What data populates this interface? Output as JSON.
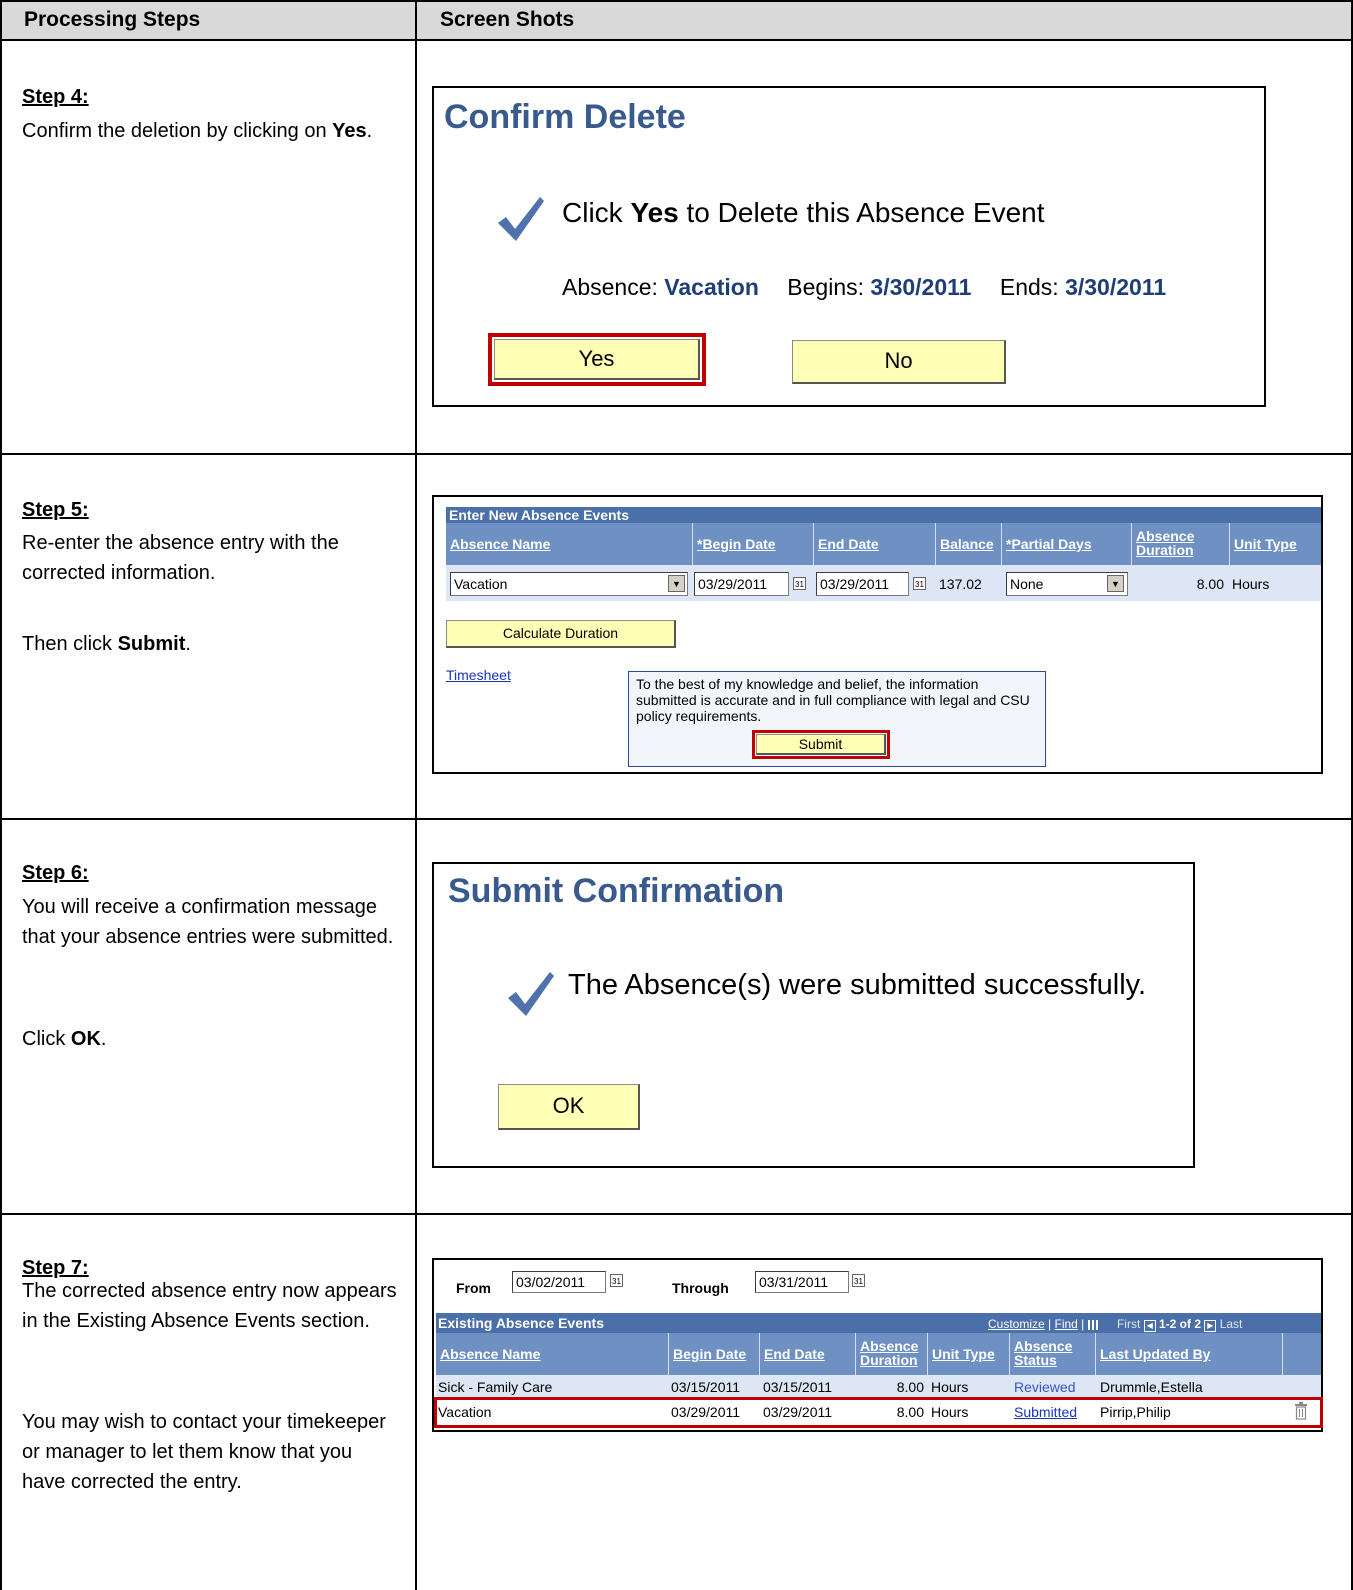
{
  "header": {
    "col1": "Processing Steps",
    "col2": "Screen Shots"
  },
  "step4": {
    "title": "Step 4:",
    "text_pre": "Confirm the deletion by clicking on ",
    "text_bold": "Yes",
    "text_post": ".",
    "shot": {
      "heading": "Confirm Delete",
      "msg_pre": "Click ",
      "msg_bold": "Yes",
      "msg_post": " to Delete this Absence Event",
      "absence_label": "Absence:",
      "absence_value": "Vacation",
      "begins_label": "Begins:",
      "begins_value": "3/30/2011",
      "ends_label": "Ends:",
      "ends_value": "3/30/2011",
      "yes_label": "Yes",
      "no_label": "No"
    }
  },
  "step5": {
    "title": "Step 5:",
    "text1": "Re-enter the absence entry with the corrected information.",
    "text2_pre": "Then click ",
    "text2_bold": "Submit",
    "text2_post": ".",
    "shot": {
      "section_title": "Enter New Absence Events",
      "columns": [
        "Absence Name",
        "*Begin Date",
        "End Date",
        "Balance",
        "*Partial Days",
        "Absence Duration",
        "Unit Type"
      ],
      "row": {
        "absence_name": "Vacation",
        "begin_date": "03/29/2011",
        "end_date": "03/29/2011",
        "balance": "137.02",
        "partial_days": "None",
        "duration": "8.00",
        "unit_type": "Hours"
      },
      "calc_button": "Calculate Duration",
      "timesheet_link": "Timesheet",
      "certification": "To the best of my knowledge and belief, the information submitted is accurate and in full compliance with legal and CSU policy requirements.",
      "submit_button": "Submit"
    }
  },
  "step6": {
    "title": "Step 6:",
    "text1": "You will receive a confirmation message that your absence entries were submitted.",
    "text2_pre": "Click ",
    "text2_bold": "OK",
    "text2_post": ".",
    "shot": {
      "heading": "Submit Confirmation",
      "message": "The Absence(s) were submitted successfully.",
      "ok_label": "OK"
    }
  },
  "step7": {
    "title": "Step 7:",
    "text1": "The corrected absence entry now appears in the Existing Absence Events section.",
    "text2": "You may wish to contact your timekeeper or manager to let them know that you have corrected the entry.",
    "shot": {
      "from_label": "From",
      "from_value": "03/02/2011",
      "through_label": "Through",
      "through_value": "03/31/2011",
      "section_title": "Existing Absence Events",
      "customize": "Customize",
      "find": "Find",
      "first": "First",
      "range": "1-2 of 2",
      "last": "Last",
      "columns": [
        "Absence Name",
        "Begin Date",
        "End Date",
        "Absence Duration",
        "Unit Type",
        "Absence Status",
        "Last Updated By"
      ],
      "rows": [
        {
          "name": "Sick - Family Care",
          "begin": "03/15/2011",
          "end": "03/15/2011",
          "duration": "8.00",
          "unit": "Hours",
          "status": "Reviewed",
          "updated_by": "Drummle,Estella"
        },
        {
          "name": "Vacation",
          "begin": "03/29/2011",
          "end": "03/29/2011",
          "duration": "8.00",
          "unit": "Hours",
          "status": "Submitted",
          "updated_by": "Pirrip,Philip"
        }
      ]
    }
  }
}
